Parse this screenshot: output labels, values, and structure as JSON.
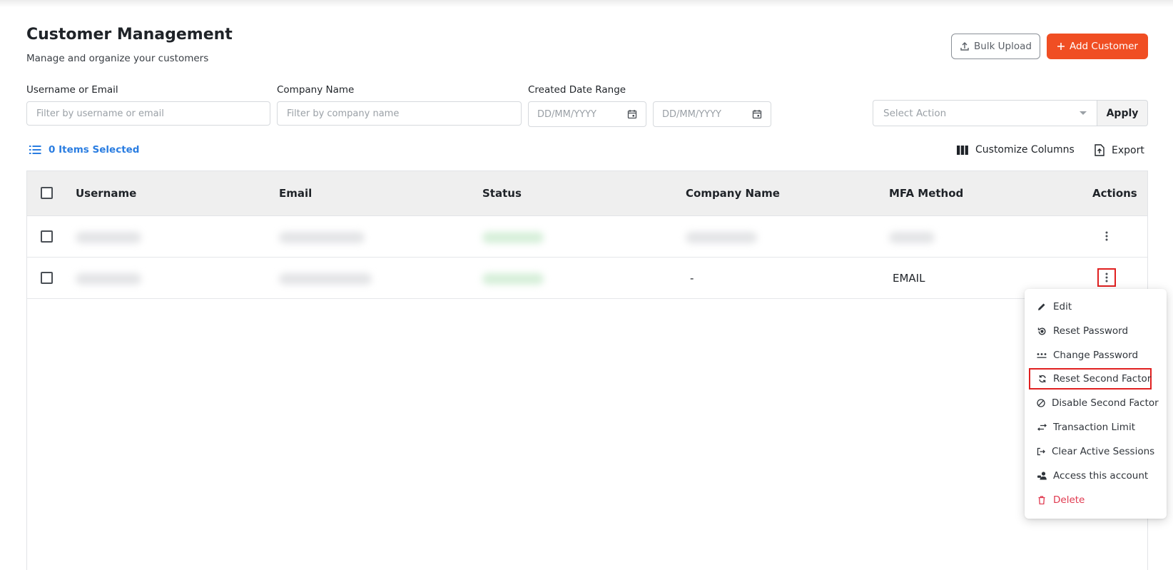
{
  "header": {
    "title": "Customer Management",
    "subtitle": "Manage and organize your customers",
    "bulk_upload_label": "Bulk Upload",
    "add_customer_label": "Add Customer"
  },
  "filters": {
    "username_label": "Username or Email",
    "username_placeholder": "Filter by username or email",
    "company_label": "Company Name",
    "company_placeholder": "Filter by company name",
    "date_label": "Created Date Range",
    "date_from_placeholder": "DD/MM/YYYY",
    "date_to_placeholder": "DD/MM/YYYY",
    "action_placeholder": "Select Action",
    "apply_label": "Apply"
  },
  "toolbar": {
    "items_selected": "0 Items Selected",
    "customize_columns": "Customize Columns",
    "export": "Export"
  },
  "table": {
    "columns": [
      "Username",
      "Email",
      "Status",
      "Company Name",
      "MFA Method",
      "Actions"
    ],
    "rows": [
      {
        "company": "",
        "mfa": ""
      },
      {
        "company": "-",
        "mfa": "EMAIL"
      }
    ]
  },
  "action_menu": {
    "items": [
      {
        "label": "Edit",
        "icon": "pencil-icon"
      },
      {
        "label": "Reset Password",
        "icon": "reset-password-icon"
      },
      {
        "label": "Change Password",
        "icon": "password-dots-icon"
      },
      {
        "label": "Reset Second Factor",
        "icon": "refresh-icon"
      },
      {
        "label": "Disable Second Factor",
        "icon": "block-icon"
      },
      {
        "label": "Transaction Limit",
        "icon": "swap-arrows-icon"
      },
      {
        "label": "Clear Active Sessions",
        "icon": "logout-icon"
      },
      {
        "label": "Access this account",
        "icon": "user-access-icon"
      },
      {
        "label": "Delete",
        "icon": "trash-icon"
      }
    ]
  },
  "colors": {
    "primary": "#f04e23",
    "link": "#2a7de1",
    "danger": "#e0394f",
    "highlight": "#e02020"
  }
}
